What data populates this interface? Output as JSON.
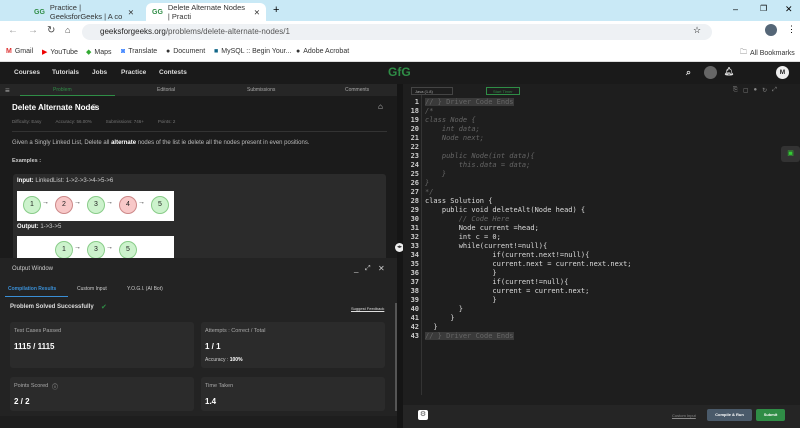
{
  "browser": {
    "tabs": [
      {
        "title": "Practice | GeeksforGeeks | A co"
      },
      {
        "title": "Delete Alternate Nodes | Practi"
      }
    ],
    "url_host": "geeksforgeeks.org",
    "url_path": "/problems/delete-alternate-nodes/1",
    "bookmarks": [
      "Gmail",
      "YouTube",
      "Maps",
      "Translate",
      "Document",
      "MySQL :: Begin Your...",
      "Adobe Acrobat"
    ],
    "all_bookmarks": "All Bookmarks"
  },
  "nav": {
    "items": [
      "Courses",
      "Tutorials",
      "Jobs",
      "Practice",
      "Contests"
    ],
    "logo": "GfG",
    "avatar": "M"
  },
  "panel_tabs": [
    "Problem",
    "Editorial",
    "Submissions",
    "Comments"
  ],
  "problem": {
    "title": "Delete Alternate Nodes",
    "meta": [
      "Difficulty: Easy",
      "Accuracy: 56.00%",
      "Submissions: 746+",
      "Points: 2"
    ],
    "desc_pre": "Given a Singly Linked List, Delete all ",
    "desc_bold": "alternate",
    "desc_post": " nodes of the list ie delete all the nodes present in even positions.",
    "examples": "Examples :",
    "input_label": "Input:",
    "input_value": "LinkedList:  1->2->3->4->5->6",
    "output_label": "Output:",
    "output_value": "1->3->5",
    "input_nodes": [
      "1",
      "2",
      "3",
      "4",
      "5"
    ],
    "output_nodes": [
      "1",
      "3",
      "5"
    ]
  },
  "output": {
    "title": "Output Window",
    "tabs": [
      "Compilation Results",
      "Custom Input",
      "Y.O.G.I. (AI Bot)"
    ],
    "status": "Problem Solved Successfully",
    "feedback": "Suggest Feedback",
    "tests_label": "Test Cases Passed",
    "tests_value": "1115 / 1115",
    "attempts_label": "Attempts : Correct / Total",
    "attempts_value": "1 / 1",
    "accuracy_label": "Accuracy :",
    "accuracy_value": "100%",
    "points_label": "Points Scored",
    "points_value": "2 / 2",
    "time_label": "Time Taken",
    "time_value": "1.4"
  },
  "editor": {
    "language": "Java (1.8)",
    "timer": "Start Timer",
    "lines": [
      [
        "1",
        "// } Driver Code Ends"
      ],
      [
        "18",
        "/*"
      ],
      [
        "19",
        "class Node {"
      ],
      [
        "20",
        "    int data;"
      ],
      [
        "21",
        "    Node next;"
      ],
      [
        "22",
        ""
      ],
      [
        "23",
        "    public Node(int data){"
      ],
      [
        "24",
        "        this.data = data;"
      ],
      [
        "25",
        "    }"
      ],
      [
        "26",
        "}"
      ],
      [
        "27",
        "*/"
      ],
      [
        "28",
        "class Solution {"
      ],
      [
        "29",
        "    public void deleteAlt(Node head) {"
      ],
      [
        "30",
        "        // Code Here"
      ],
      [
        "31",
        "        Node current =head;"
      ],
      [
        "32",
        "        int c = 0;"
      ],
      [
        "33",
        "        while(current!=null){"
      ],
      [
        "34",
        "                if(current.next!=null){"
      ],
      [
        "35",
        "                current.next = current.next.next;"
      ],
      [
        "36",
        "                }"
      ],
      [
        "37",
        "                if(current!=null){"
      ],
      [
        "38",
        "                current = current.next;"
      ],
      [
        "39",
        "                }"
      ],
      [
        "40",
        "        }"
      ],
      [
        "41",
        "      }"
      ],
      [
        "42",
        "  }"
      ],
      [
        "43",
        "// } Driver Code Ends"
      ]
    ]
  },
  "bottom": {
    "custom_input": "Custom Input",
    "compile": "Compile & Run",
    "submit": "Submit"
  }
}
